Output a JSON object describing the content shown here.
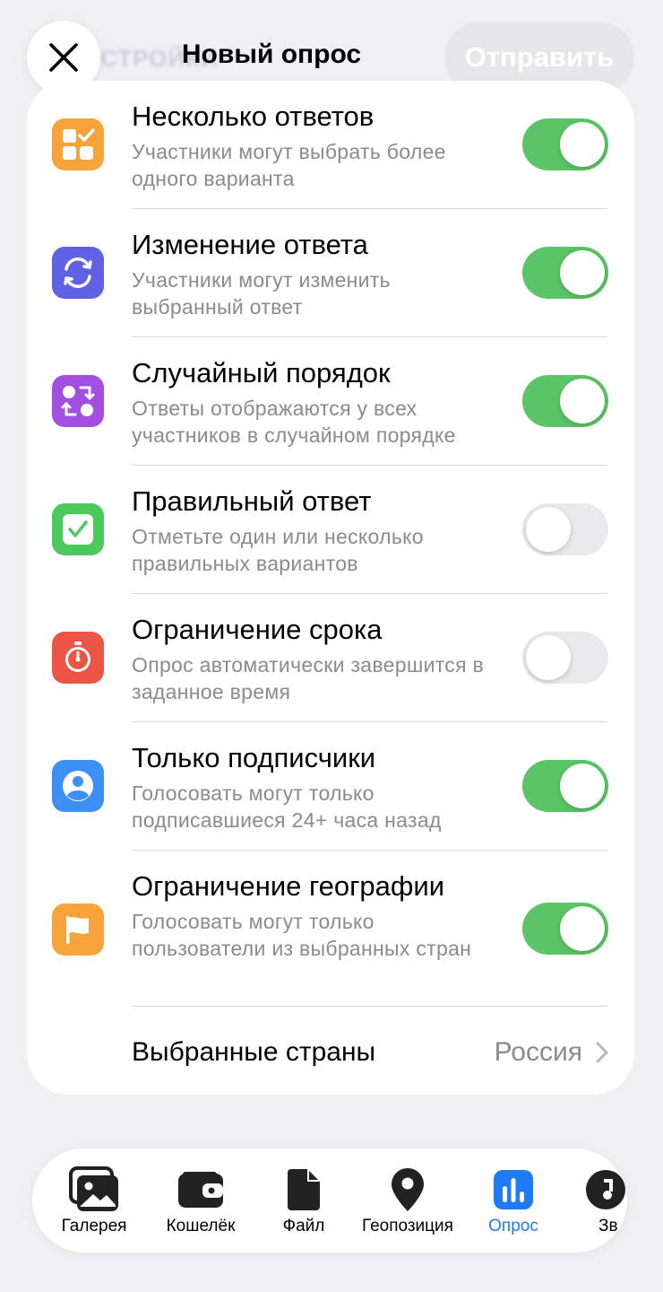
{
  "header": {
    "title": "Новый опрос",
    "send_label": "Отправить",
    "ghost_text": "СТРОЙКИ"
  },
  "settings": [
    {
      "label": "Несколько ответов",
      "description": "Участники могут выбрать более одного варианта",
      "enabled": true,
      "icon": "multiple-answers-icon",
      "icon_color": "#f5a33a"
    },
    {
      "label": "Изменение ответа",
      "description": "Участники могут изменить выбранный ответ",
      "enabled": true,
      "icon": "change-answer-icon",
      "icon_color": "#6161e6"
    },
    {
      "label": "Случайный порядок",
      "description": "Ответы отображаются у всех участников в случайном порядке",
      "enabled": true,
      "icon": "shuffle-icon",
      "icon_color": "#a04fe0"
    },
    {
      "label": "Правильный ответ",
      "description": "Отметьте один или несколько правильных вариантов",
      "enabled": false,
      "icon": "checkmark-icon",
      "icon_color": "#4cc95c"
    },
    {
      "label": "Ограничение срока",
      "description": "Опрос автоматически завершится в заданное время",
      "enabled": false,
      "icon": "stopwatch-icon",
      "icon_color": "#ec5545"
    },
    {
      "label": "Только подписчики",
      "description": "Голосовать могут только подписавшиеся 24+ часа назад",
      "enabled": true,
      "icon": "person-icon",
      "icon_color": "#3d8ef5"
    },
    {
      "label": "Ограничение географии",
      "description": "Голосовать могут только пользователи из выбранных стран",
      "enabled": true,
      "icon": "flag-icon",
      "icon_color": "#f5a33a"
    }
  ],
  "countries": {
    "label": "Выбранные страны",
    "value": "Россия"
  },
  "tabs": [
    {
      "label": "Галерея",
      "icon": "gallery-icon",
      "active": false
    },
    {
      "label": "Кошелёк",
      "icon": "wallet-icon",
      "active": false
    },
    {
      "label": "Файл",
      "icon": "file-icon",
      "active": false
    },
    {
      "label": "Геопозиция",
      "icon": "location-icon",
      "active": false
    },
    {
      "label": "Опрос",
      "icon": "poll-icon",
      "active": true
    },
    {
      "label": "Зв",
      "icon": "music-icon",
      "active": false
    }
  ],
  "colors": {
    "toggle_on": "#5ac466",
    "toggle_off": "#e9e9eb",
    "accent": "#1f7af5"
  }
}
